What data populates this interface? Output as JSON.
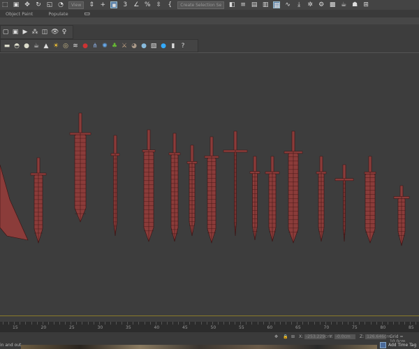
{
  "toolbar": {
    "view_dropdown": "View",
    "selection_set": "Create Selection Se"
  },
  "tabs": [
    {
      "label": "Object Paint"
    },
    {
      "label": "Populate"
    }
  ],
  "timeline": {
    "ticks": [
      "15",
      "20",
      "25",
      "30",
      "35",
      "40",
      "45",
      "50",
      "55",
      "60",
      "65",
      "70",
      "75",
      "80",
      "85"
    ]
  },
  "status": {
    "x_label": "X:",
    "x_value": "-253.229cm",
    "y_label": "Y:",
    "y_value": "-0.0cm",
    "z_label": "Z:",
    "z_value": "126.646cm",
    "grid": "Grid = 10.0cm",
    "prompt": "in and out",
    "add_time_tag": "Add Time Tag"
  },
  "colors": {
    "mesh": "#8b3c3a",
    "wire": "#3a1212",
    "accent": "#5a7fa8"
  }
}
